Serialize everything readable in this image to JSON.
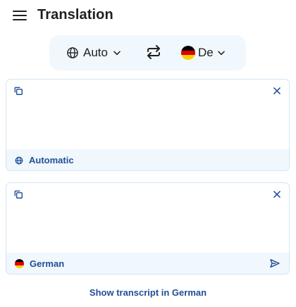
{
  "header": {
    "title": "Translation",
    "menu_icon": "hamburger-menu-icon"
  },
  "language_bar": {
    "source_label": "Auto",
    "source_icon": "globe-icon",
    "swap_icon": "swap-arrows-icon",
    "target_label": "De",
    "target_flag": "germany-flag-icon"
  },
  "source_panel": {
    "text": "",
    "language_label": "Automatic",
    "language_icon": "globe-icon"
  },
  "target_panel": {
    "text": "",
    "language_label": "German",
    "language_icon": "germany-flag-icon",
    "send_icon": "send-icon"
  },
  "transcript_link": "Show transcript in German",
  "colors": {
    "accent": "#1f4e96",
    "panel_fill": "#f0f7fd",
    "panel_border": "#d3e6f5",
    "flag_black": "#000000",
    "flag_red": "#dd0000",
    "flag_gold": "#ffce00"
  }
}
